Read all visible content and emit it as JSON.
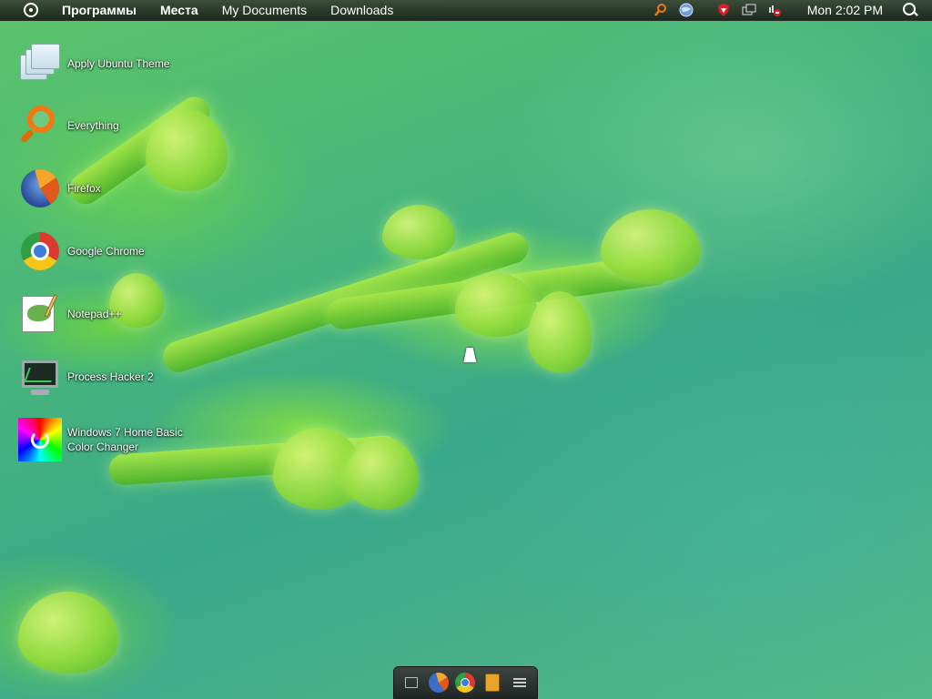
{
  "top_panel": {
    "menu": [
      "Программы",
      "Места",
      "My Documents",
      "Downloads"
    ],
    "clock": "Mon 2:02 PM",
    "tray_icons": [
      "everything-search-icon",
      "globe-icon",
      "shield-icon",
      "window-switcher-icon",
      "network-icon"
    ]
  },
  "desktop": {
    "icons": [
      {
        "label": "Apply Ubuntu Theme",
        "icon": "theme-icon"
      },
      {
        "label": "Everything",
        "icon": "everything-icon"
      },
      {
        "label": "Firefox",
        "icon": "firefox-icon"
      },
      {
        "label": "Google Chrome",
        "icon": "chrome-icon"
      },
      {
        "label": "Notepad++",
        "icon": "notepad-plus-plus-icon"
      },
      {
        "label": "Process Hacker 2",
        "icon": "process-hacker-icon"
      },
      {
        "label": "Windows 7 Home Basic Color Changer",
        "icon": "color-changer-icon"
      }
    ]
  },
  "dock": {
    "items": [
      "show-desktop-icon",
      "firefox-icon",
      "chrome-icon",
      "book-icon",
      "menu-icon"
    ]
  },
  "colors": {
    "panel": "#242c22",
    "accent_orange": "#f07a10"
  }
}
